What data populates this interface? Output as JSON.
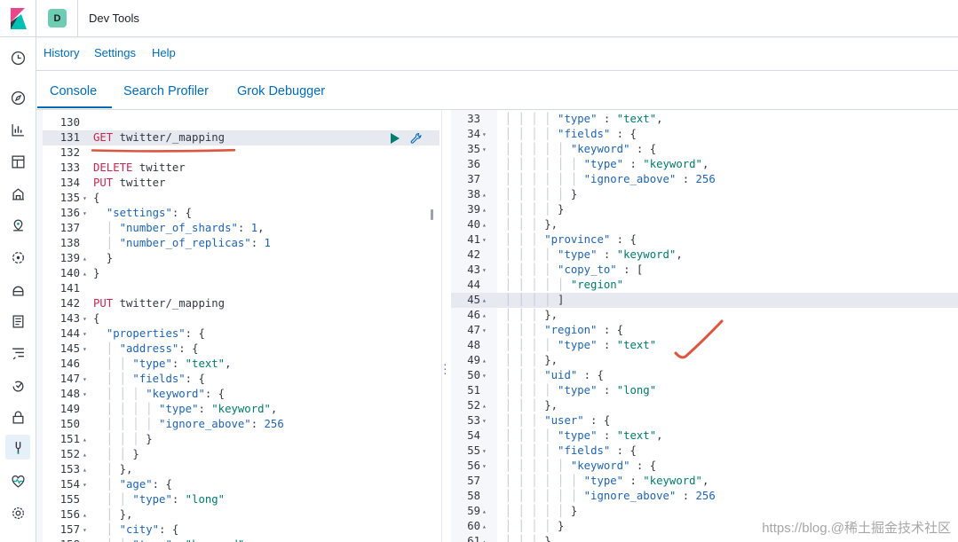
{
  "header": {
    "space_initial": "D",
    "title": "Dev Tools"
  },
  "top_menu": [
    "History",
    "Settings",
    "Help"
  ],
  "tabs": [
    "Console",
    "Search Profiler",
    "Grok Debugger"
  ],
  "nav_icons": [
    "clock-icon",
    "compass-icon",
    "visualize-icon",
    "dashboard-icon",
    "canvas-icon",
    "maps-icon",
    "ml-icon",
    "infrastructure-icon",
    "logs-icon",
    "apm-icon",
    "uptime-icon",
    "security-icon",
    "devtools-icon",
    "monitoring-icon",
    "management-icon"
  ],
  "left_editor": {
    "lines": [
      {
        "n": "130",
        "f": "",
        "t": []
      },
      {
        "n": "131",
        "f": "",
        "hl": true,
        "t": [
          [
            "m",
            "GET"
          ],
          [
            "u",
            " twitter/_mapping"
          ]
        ]
      },
      {
        "n": "132",
        "f": "",
        "t": []
      },
      {
        "n": "133",
        "f": "",
        "t": [
          [
            "m",
            "DELETE"
          ],
          [
            "u",
            " twitter"
          ]
        ]
      },
      {
        "n": "134",
        "f": "",
        "t": [
          [
            "m",
            "PUT"
          ],
          [
            "u",
            " twitter"
          ]
        ]
      },
      {
        "n": "135",
        "f": "▾",
        "t": [
          [
            "p",
            "{"
          ]
        ]
      },
      {
        "n": "136",
        "f": "▾",
        "t": [
          [
            "p",
            "  "
          ],
          [
            "k",
            "\"settings\""
          ],
          [
            "p",
            ": {"
          ]
        ]
      },
      {
        "n": "137",
        "f": "",
        "t": [
          [
            "g",
            "  │ "
          ],
          [
            "k",
            "\"number_of_shards\""
          ],
          [
            "p",
            ": "
          ],
          [
            "n",
            "1"
          ],
          [
            "p",
            ","
          ]
        ]
      },
      {
        "n": "138",
        "f": "",
        "t": [
          [
            "g",
            "  │ "
          ],
          [
            "k",
            "\"number_of_replicas\""
          ],
          [
            "p",
            ": "
          ],
          [
            "n",
            "1"
          ]
        ]
      },
      {
        "n": "139",
        "f": "▴",
        "t": [
          [
            "p",
            "  }"
          ]
        ]
      },
      {
        "n": "140",
        "f": "▴",
        "t": [
          [
            "p",
            "}"
          ]
        ]
      },
      {
        "n": "141",
        "f": "",
        "t": []
      },
      {
        "n": "142",
        "f": "",
        "t": [
          [
            "m",
            "PUT"
          ],
          [
            "u",
            " twitter/_mapping"
          ]
        ]
      },
      {
        "n": "143",
        "f": "▾",
        "t": [
          [
            "p",
            "{"
          ]
        ]
      },
      {
        "n": "144",
        "f": "▾",
        "t": [
          [
            "p",
            "  "
          ],
          [
            "k",
            "\"properties\""
          ],
          [
            "p",
            ": {"
          ]
        ]
      },
      {
        "n": "145",
        "f": "▾",
        "t": [
          [
            "g",
            "  │ "
          ],
          [
            "k",
            "\"address\""
          ],
          [
            "p",
            ": {"
          ]
        ]
      },
      {
        "n": "146",
        "f": "",
        "t": [
          [
            "g",
            "  │ │ "
          ],
          [
            "k",
            "\"type\""
          ],
          [
            "p",
            ": "
          ],
          [
            "s",
            "\"text\""
          ],
          [
            "p",
            ","
          ]
        ]
      },
      {
        "n": "147",
        "f": "▾",
        "t": [
          [
            "g",
            "  │ │ "
          ],
          [
            "k",
            "\"fields\""
          ],
          [
            "p",
            ": {"
          ]
        ]
      },
      {
        "n": "148",
        "f": "▾",
        "t": [
          [
            "g",
            "  │ │ │ "
          ],
          [
            "k",
            "\"keyword\""
          ],
          [
            "p",
            ": {"
          ]
        ]
      },
      {
        "n": "149",
        "f": "",
        "t": [
          [
            "g",
            "  │ │ │ │ "
          ],
          [
            "k",
            "\"type\""
          ],
          [
            "p",
            ": "
          ],
          [
            "s",
            "\"keyword\""
          ],
          [
            "p",
            ","
          ]
        ]
      },
      {
        "n": "150",
        "f": "",
        "t": [
          [
            "g",
            "  │ │ │ │ "
          ],
          [
            "k",
            "\"ignore_above\""
          ],
          [
            "p",
            ": "
          ],
          [
            "n",
            "256"
          ]
        ]
      },
      {
        "n": "151",
        "f": "▴",
        "t": [
          [
            "g",
            "  │ │ │ "
          ],
          [
            "p",
            "}"
          ]
        ]
      },
      {
        "n": "152",
        "f": "▴",
        "t": [
          [
            "g",
            "  │ │ "
          ],
          [
            "p",
            "}"
          ]
        ]
      },
      {
        "n": "153",
        "f": "▴",
        "t": [
          [
            "g",
            "  │ "
          ],
          [
            "p",
            "},"
          ]
        ]
      },
      {
        "n": "154",
        "f": "▾",
        "t": [
          [
            "g",
            "  │ "
          ],
          [
            "k",
            "\"age\""
          ],
          [
            "p",
            ": {"
          ]
        ]
      },
      {
        "n": "155",
        "f": "",
        "t": [
          [
            "g",
            "  │ │ "
          ],
          [
            "k",
            "\"type\""
          ],
          [
            "p",
            ": "
          ],
          [
            "s",
            "\"long\""
          ]
        ]
      },
      {
        "n": "156",
        "f": "▴",
        "t": [
          [
            "g",
            "  │ "
          ],
          [
            "p",
            "},"
          ]
        ]
      },
      {
        "n": "157",
        "f": "▾",
        "t": [
          [
            "g",
            "  │ "
          ],
          [
            "k",
            "\"city\""
          ],
          [
            "p",
            ": {"
          ]
        ]
      },
      {
        "n": "158",
        "f": "",
        "t": [
          [
            "g",
            "  │ │ "
          ],
          [
            "k",
            "\"type\""
          ],
          [
            "p",
            ": "
          ],
          [
            "s",
            "\"keyword\""
          ]
        ]
      }
    ]
  },
  "right_editor": {
    "lines": [
      {
        "n": "33",
        "f": "",
        "t": [
          [
            "g",
            "  │ │ │ │ "
          ],
          [
            "k",
            "\"type\""
          ],
          [
            "p",
            " : "
          ],
          [
            "s",
            "\"text\""
          ],
          [
            "p",
            ","
          ]
        ]
      },
      {
        "n": "34",
        "f": "▾",
        "t": [
          [
            "g",
            "  │ │ │ │ "
          ],
          [
            "k",
            "\"fields\""
          ],
          [
            "p",
            " : {"
          ]
        ]
      },
      {
        "n": "35",
        "f": "▾",
        "t": [
          [
            "g",
            "  │ │ │ │ │ "
          ],
          [
            "k",
            "\"keyword\""
          ],
          [
            "p",
            " : {"
          ]
        ]
      },
      {
        "n": "36",
        "f": "",
        "t": [
          [
            "g",
            "  │ │ │ │ │ │ "
          ],
          [
            "k",
            "\"type\""
          ],
          [
            "p",
            " : "
          ],
          [
            "s",
            "\"keyword\""
          ],
          [
            "p",
            ","
          ]
        ]
      },
      {
        "n": "37",
        "f": "",
        "t": [
          [
            "g",
            "  │ │ │ │ │ │ "
          ],
          [
            "k",
            "\"ignore_above\""
          ],
          [
            "p",
            " : "
          ],
          [
            "n",
            "256"
          ]
        ]
      },
      {
        "n": "38",
        "f": "▴",
        "t": [
          [
            "g",
            "  │ │ │ │ │ "
          ],
          [
            "p",
            "}"
          ]
        ]
      },
      {
        "n": "39",
        "f": "▴",
        "t": [
          [
            "g",
            "  │ │ │ │ "
          ],
          [
            "p",
            "}"
          ]
        ]
      },
      {
        "n": "40",
        "f": "▴",
        "t": [
          [
            "g",
            "  │ │ │ "
          ],
          [
            "p",
            "},"
          ]
        ]
      },
      {
        "n": "41",
        "f": "▾",
        "t": [
          [
            "g",
            "  │ │ │ "
          ],
          [
            "k",
            "\"province\""
          ],
          [
            "p",
            " : {"
          ]
        ]
      },
      {
        "n": "42",
        "f": "",
        "t": [
          [
            "g",
            "  │ │ │ │ "
          ],
          [
            "k",
            "\"type\""
          ],
          [
            "p",
            " : "
          ],
          [
            "s",
            "\"keyword\""
          ],
          [
            "p",
            ","
          ]
        ]
      },
      {
        "n": "43",
        "f": "▾",
        "t": [
          [
            "g",
            "  │ │ │ │ "
          ],
          [
            "k",
            "\"copy_to\""
          ],
          [
            "p",
            " : ["
          ]
        ]
      },
      {
        "n": "44",
        "f": "",
        "t": [
          [
            "g",
            "  │ │ │ │ │ "
          ],
          [
            "s",
            "\"region\""
          ]
        ]
      },
      {
        "n": "45",
        "f": "▴",
        "hl": true,
        "t": [
          [
            "g",
            "  │ │ │ │ "
          ],
          [
            "p",
            "]"
          ]
        ]
      },
      {
        "n": "46",
        "f": "▴",
        "t": [
          [
            "g",
            "  │ │ │ "
          ],
          [
            "p",
            "},"
          ]
        ]
      },
      {
        "n": "47",
        "f": "▾",
        "t": [
          [
            "g",
            "  │ │ │ "
          ],
          [
            "k",
            "\"region\""
          ],
          [
            "p",
            " : {"
          ]
        ]
      },
      {
        "n": "48",
        "f": "",
        "t": [
          [
            "g",
            "  │ │ │ │ "
          ],
          [
            "k",
            "\"type\""
          ],
          [
            "p",
            " : "
          ],
          [
            "s",
            "\"text\""
          ]
        ]
      },
      {
        "n": "49",
        "f": "▴",
        "t": [
          [
            "g",
            "  │ │ │ "
          ],
          [
            "p",
            "},"
          ]
        ]
      },
      {
        "n": "50",
        "f": "▾",
        "t": [
          [
            "g",
            "  │ │ │ "
          ],
          [
            "k",
            "\"uid\""
          ],
          [
            "p",
            " : {"
          ]
        ]
      },
      {
        "n": "51",
        "f": "",
        "t": [
          [
            "g",
            "  │ │ │ │ "
          ],
          [
            "k",
            "\"type\""
          ],
          [
            "p",
            " : "
          ],
          [
            "s",
            "\"long\""
          ]
        ]
      },
      {
        "n": "52",
        "f": "▴",
        "t": [
          [
            "g",
            "  │ │ │ "
          ],
          [
            "p",
            "},"
          ]
        ]
      },
      {
        "n": "53",
        "f": "▾",
        "t": [
          [
            "g",
            "  │ │ │ "
          ],
          [
            "k",
            "\"user\""
          ],
          [
            "p",
            " : {"
          ]
        ]
      },
      {
        "n": "54",
        "f": "",
        "t": [
          [
            "g",
            "  │ │ │ │ "
          ],
          [
            "k",
            "\"type\""
          ],
          [
            "p",
            " : "
          ],
          [
            "s",
            "\"text\""
          ],
          [
            "p",
            ","
          ]
        ]
      },
      {
        "n": "55",
        "f": "▾",
        "t": [
          [
            "g",
            "  │ │ │ │ "
          ],
          [
            "k",
            "\"fields\""
          ],
          [
            "p",
            " : {"
          ]
        ]
      },
      {
        "n": "56",
        "f": "▾",
        "t": [
          [
            "g",
            "  │ │ │ │ │ "
          ],
          [
            "k",
            "\"keyword\""
          ],
          [
            "p",
            " : {"
          ]
        ]
      },
      {
        "n": "57",
        "f": "",
        "t": [
          [
            "g",
            "  │ │ │ │ │ │ "
          ],
          [
            "k",
            "\"type\""
          ],
          [
            "p",
            " : "
          ],
          [
            "s",
            "\"keyword\""
          ],
          [
            "p",
            ","
          ]
        ]
      },
      {
        "n": "58",
        "f": "",
        "t": [
          [
            "g",
            "  │ │ │ │ │ │ "
          ],
          [
            "k",
            "\"ignore_above\""
          ],
          [
            "p",
            " : "
          ],
          [
            "n",
            "256"
          ]
        ]
      },
      {
        "n": "59",
        "f": "▴",
        "t": [
          [
            "g",
            "  │ │ │ │ │ "
          ],
          [
            "p",
            "}"
          ]
        ]
      },
      {
        "n": "60",
        "f": "▴",
        "t": [
          [
            "g",
            "  │ │ │ │ "
          ],
          [
            "p",
            "}"
          ]
        ]
      },
      {
        "n": "61",
        "f": "▴",
        "t": [
          [
            "g",
            "  │ │ │ "
          ],
          [
            "p",
            "}"
          ]
        ]
      }
    ]
  },
  "watermark": "https://blog.@稀土掘金技术社区",
  "colors": {
    "accent": "#006bb4",
    "method": "#c7254e",
    "key": "#1e63ae",
    "string": "#00796b",
    "annotation": "#e0533e"
  }
}
